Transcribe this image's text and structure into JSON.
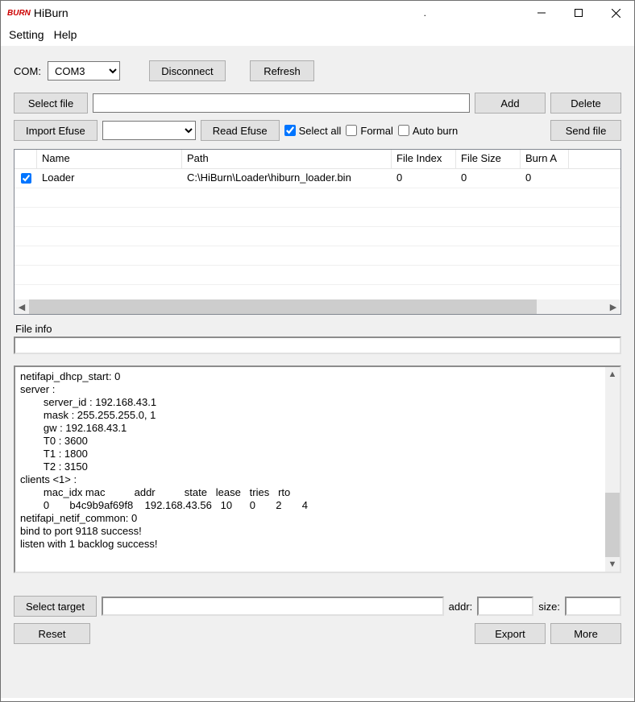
{
  "title": "HiBurn",
  "logo": "BURN",
  "titlebar_dot": ".",
  "menu": {
    "setting": "Setting",
    "help": "Help"
  },
  "com": {
    "label": "COM:",
    "selected": "COM3"
  },
  "buttons": {
    "disconnect": "Disconnect",
    "refresh": "Refresh",
    "select_file": "Select file",
    "add": "Add",
    "delete": "Delete",
    "import_efuse": "Import Efuse",
    "read_efuse": "Read Efuse",
    "send_file": "Send file",
    "select_target": "Select target",
    "reset": "Reset",
    "export": "Export",
    "more": "More"
  },
  "checks": {
    "select_all": "Select all",
    "formal": "Formal",
    "auto_burn": "Auto burn"
  },
  "file_path_value": "",
  "efuse_combo_value": "",
  "table": {
    "headers": {
      "name": "Name",
      "path": "Path",
      "file_index": "File Index",
      "file_size": "File Size",
      "burn_a": "Burn A"
    },
    "row0": {
      "name": "Loader",
      "path": "C:\\HiBurn\\Loader\\hiburn_loader.bin",
      "idx": "0",
      "size": "0",
      "burn": "0"
    }
  },
  "file_info_label": "File info",
  "console_text": "netifapi_dhcp_start: 0\nserver :\n\tserver_id : 192.168.43.1\n\tmask : 255.255.255.0, 1\n\tgw : 192.168.43.1\n\tT0 : 3600\n\tT1 : 1800\n\tT2 : 3150\nclients <1> :\n\tmac_idx mac          addr          state   lease   tries   rto\n\t0       b4c9b9af69f8    192.168.43.56   10      0       2       4\nnetifapi_netif_common: 0\nbind to port 9118 success!\nlisten with 1 backlog success!",
  "bottom": {
    "target_value": "",
    "addr_label": "addr:",
    "addr_value": "",
    "size_label": "size:",
    "size_value": ""
  }
}
